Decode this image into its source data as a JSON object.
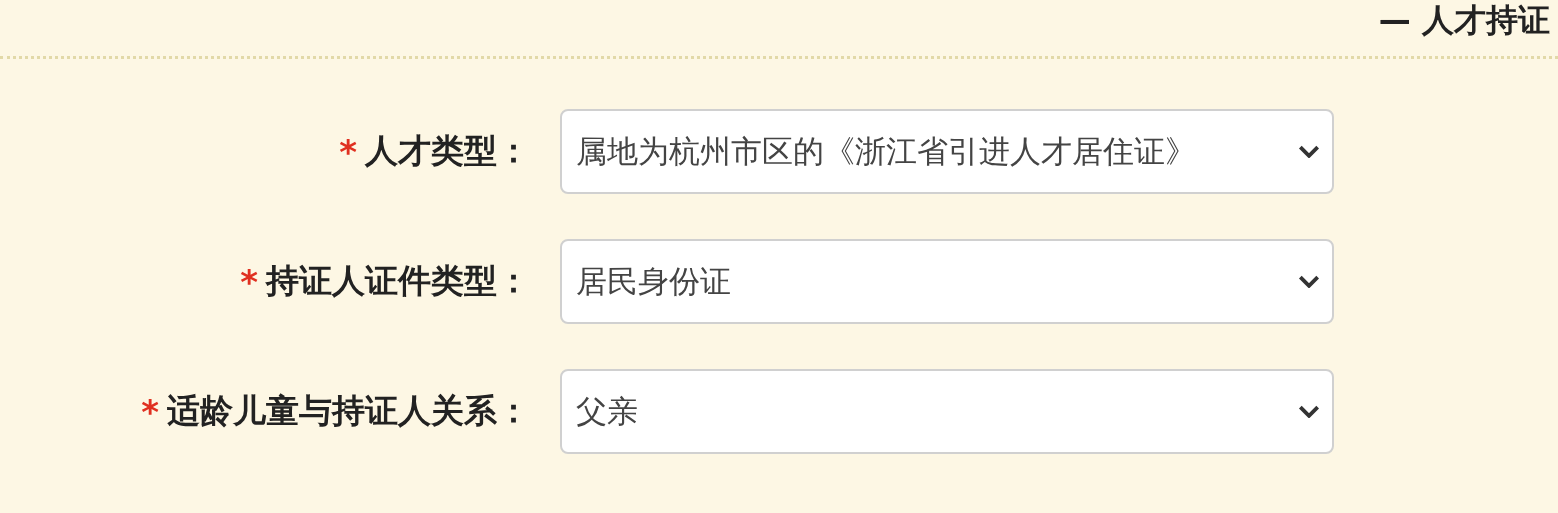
{
  "section_title": "— 人才持证",
  "fields": [
    {
      "label": "人才类型：",
      "required": true,
      "required_mark": "*",
      "value": "属地为杭州市区的《浙江省引进人才居住证》"
    },
    {
      "label": "持证人证件类型：",
      "required": true,
      "required_mark": "*",
      "value": "居民身份证"
    },
    {
      "label": "适龄儿童与持证人关系：",
      "required": true,
      "required_mark": "*",
      "value": "父亲"
    }
  ]
}
